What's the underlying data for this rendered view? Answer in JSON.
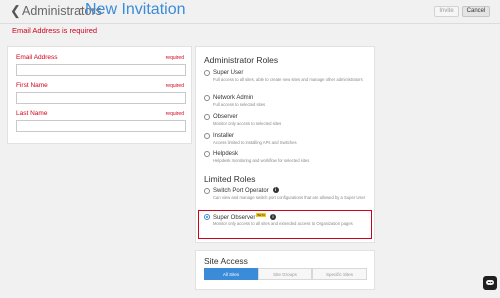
{
  "header": {
    "back_icon": "chevron-left-icon",
    "breadcrumb": "Administrators",
    "separator": ":",
    "title": "New Invitation",
    "invite_label": "Invite",
    "cancel_label": "Cancel"
  },
  "error": "Email Address is required",
  "form": {
    "fields": [
      {
        "label": "Email Address",
        "required": "required",
        "value": ""
      },
      {
        "label": "First Name",
        "required": "required",
        "value": ""
      },
      {
        "label": "Last Name",
        "required": "required",
        "value": ""
      }
    ]
  },
  "admin_roles": {
    "title": "Administrator Roles",
    "items": [
      {
        "label": "Super User",
        "desc": "Full access to all sites, able to create new sites and manage other administrators"
      },
      {
        "label": "Network Admin",
        "desc": "Full access to selected sites"
      },
      {
        "label": "Observer",
        "desc": "Monitor only access to selected sites"
      },
      {
        "label": "Installer",
        "desc": "Access limited to installing APs and Switches"
      },
      {
        "label": "Helpdesk",
        "desc": "Helpdesk monitoring and workflow for selected sites"
      }
    ]
  },
  "limited_roles": {
    "title": "Limited Roles",
    "items": [
      {
        "label": "Switch Port Operator",
        "desc": "Can view and manage switch port configurations that are allowed by a Super User"
      },
      {
        "label": "Super Observer",
        "badge": "BETA",
        "desc": "Monitor only access to all sites and extended access to Organization pages"
      }
    ],
    "selected": "Super Observer"
  },
  "site_access": {
    "title": "Site Access",
    "options": [
      "All Sites",
      "Site Groups",
      "Specific Sites"
    ],
    "selected": "All Sites"
  },
  "colors": {
    "accent": "#3a8bd8",
    "error": "#d0021b"
  }
}
